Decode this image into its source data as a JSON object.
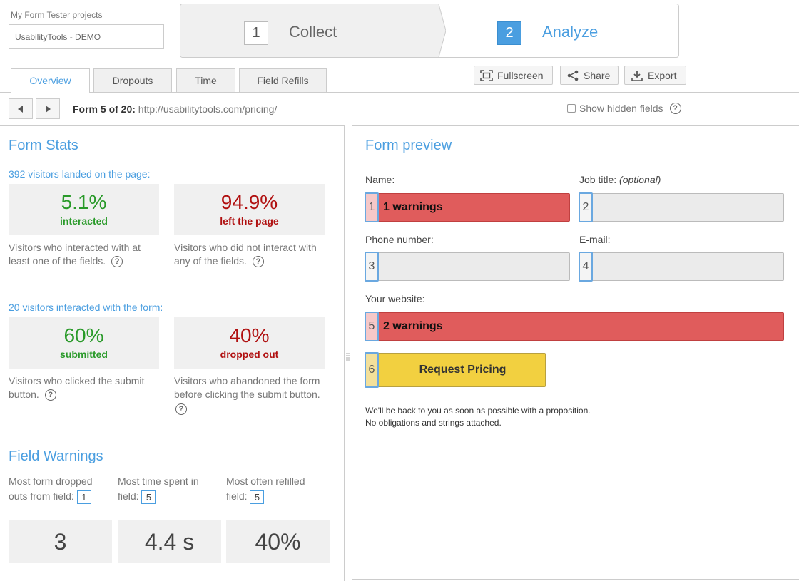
{
  "header": {
    "projects_link": "My Form Tester projects",
    "project_name": "UsabilityTools - DEMO",
    "steps": [
      {
        "num": "1",
        "label": "Collect"
      },
      {
        "num": "2",
        "label": "Analyze"
      }
    ]
  },
  "tabs": [
    "Overview",
    "Dropouts",
    "Time",
    "Field Refills"
  ],
  "toolbar": {
    "fullscreen": "Fullscreen",
    "share": "Share",
    "export": "Export"
  },
  "nav": {
    "form_prefix": "Form 5 of 20:",
    "form_url": "http://usabilitytools.com/pricing/",
    "show_hidden": "Show hidden fields"
  },
  "form_stats": {
    "title": "Form Stats",
    "landed": "392 visitors landed on the page:",
    "interacted_pct": "5.1%",
    "interacted_label": "interacted",
    "interacted_desc": "Visitors who interacted with at least one of the fields.",
    "left_pct": "94.9%",
    "left_label": "left the page",
    "left_desc": "Visitors who did not interact with any of the fields.",
    "form_interacted": "20 visitors interacted with the form:",
    "submitted_pct": "60%",
    "submitted_label": "submitted",
    "submitted_desc": "Visitors who clicked the submit button.",
    "dropped_pct": "40%",
    "dropped_label": "dropped out",
    "dropped_desc": "Visitors who abandoned the form before clicking the submit button."
  },
  "field_warnings": {
    "title": "Field Warnings",
    "items": [
      {
        "label": "Most form dropped outs from field:",
        "field": "1",
        "value": "3"
      },
      {
        "label": "Most time spent in field:",
        "field": "5",
        "value": "4.4 s"
      },
      {
        "label": "Most often refilled field:",
        "field": "5",
        "value": "40%"
      }
    ]
  },
  "form_preview": {
    "title": "Form preview",
    "name_label": "Name:",
    "job_label": "Job title:",
    "job_optional": "(optional)",
    "phone_label": "Phone number:",
    "email_label": "E-mail:",
    "website_label": "Your website:",
    "fields": [
      {
        "num": "1",
        "warning": "1 warnings"
      },
      {
        "num": "2",
        "warning": ""
      },
      {
        "num": "3",
        "warning": ""
      },
      {
        "num": "4",
        "warning": ""
      },
      {
        "num": "5",
        "warning": "2 warnings"
      },
      {
        "num": "6",
        "warning": ""
      }
    ],
    "submit_label": "Request Pricing",
    "note_line1": "We'll be back to you as soon as possible with a proposition.",
    "note_line2": "No obligations and strings attached."
  },
  "colors": {
    "accent": "#4a9ee0",
    "positive": "#2a9a2a",
    "negative": "#b01010",
    "warning_field": "#e05c5c",
    "submit": "#f2d040"
  },
  "icons": {
    "help": "?",
    "prev": "triangle-left",
    "next": "triangle-right"
  }
}
